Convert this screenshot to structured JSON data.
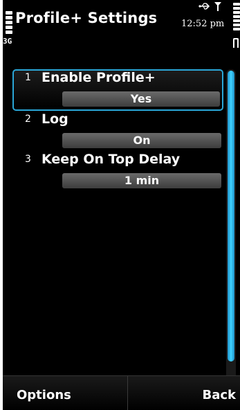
{
  "status": {
    "network": "3G",
    "time": "12:52 pm"
  },
  "header": {
    "title": "Profile+ Settings"
  },
  "settings": [
    {
      "number": "1",
      "label": "Enable Profile+",
      "value": "Yes"
    },
    {
      "number": "2",
      "label": "Log",
      "value": "On"
    },
    {
      "number": "3",
      "label": "Keep On Top Delay",
      "value": "1 min"
    }
  ],
  "softkeys": {
    "left": "Options",
    "right": "Back"
  },
  "colors": {
    "background": "#000000",
    "accent": "#2aa7d8",
    "scrollbar": "#3fd3ff"
  },
  "icons": {
    "signal": "signal-strength-icon",
    "usb": "usb-icon",
    "antenna": "antenna-icon",
    "battery": "battery-icon"
  }
}
